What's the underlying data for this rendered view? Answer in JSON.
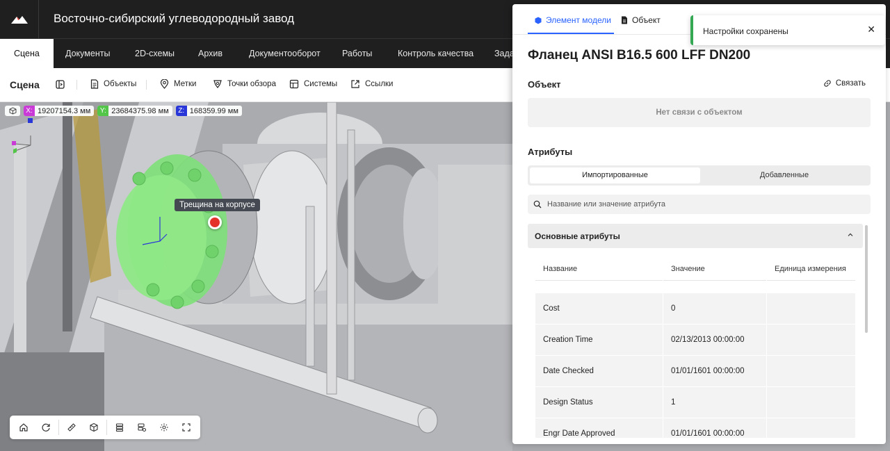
{
  "app": {
    "title": "Восточно-сибирский углеводородный завод"
  },
  "nav": {
    "items": [
      {
        "label": "Сцена",
        "active": true
      },
      {
        "label": "Документы"
      },
      {
        "label": "2D-схемы"
      },
      {
        "label": "Архив"
      },
      {
        "label": "Документооборот"
      },
      {
        "label": "Работы"
      },
      {
        "label": "Контроль качества"
      },
      {
        "label": "Задач"
      }
    ]
  },
  "toolbar": {
    "title": "Сцена",
    "items": [
      {
        "label": "Объекты",
        "icon": "document-icon"
      },
      {
        "label": "Метки",
        "icon": "pin-icon"
      },
      {
        "label": "Точки обзора",
        "icon": "viewpoint-icon"
      },
      {
        "label": "Системы",
        "icon": "systems-icon"
      },
      {
        "label": "Ссылки",
        "icon": "link-out-icon"
      }
    ]
  },
  "scene": {
    "coords": {
      "x_label": "X:",
      "x": "19207154.3 мм",
      "y_label": "Y:",
      "y": "23684375.98 мм",
      "z_label": "Z:",
      "z": "168359.99 мм"
    },
    "tooltip": "Трещина на корпусе",
    "colors": {
      "highlight": "#7fe07a",
      "marker": "#e4322b",
      "x_axis": "#c93ad6",
      "y_axis": "#53c64a",
      "z_axis": "#2a37d8"
    }
  },
  "panel": {
    "tabs": [
      {
        "label": "Элемент модели",
        "active": true
      },
      {
        "label": "Объект"
      }
    ],
    "title": "Фланец ANSI B16.5 600 LFF DN200",
    "object_section": {
      "heading": "Объект",
      "link_label": "Связать",
      "empty": "Нет связи с объектом"
    },
    "attributes_section": {
      "heading": "Атрибуты",
      "segments": [
        "Импортированные",
        "Добавленные"
      ],
      "search_placeholder": "Название или значение атрибута",
      "group_title": "Основные атрибуты",
      "columns": [
        "Название",
        "Значение",
        "Единица измерения"
      ],
      "rows": [
        {
          "name": "Cost",
          "value": "0",
          "unit": ""
        },
        {
          "name": "Creation Time",
          "value": "02/13/2013 00:00:00",
          "unit": ""
        },
        {
          "name": "Date Checked",
          "value": "01/01/1601 00:00:00",
          "unit": ""
        },
        {
          "name": "Design Status",
          "value": "1",
          "unit": ""
        },
        {
          "name": "Engr Date Approved",
          "value": "01/01/1601 00:00:00",
          "unit": ""
        }
      ]
    }
  },
  "toast": {
    "text": "Настройки сохранены",
    "close": "✕",
    "accent": "#34a853"
  }
}
